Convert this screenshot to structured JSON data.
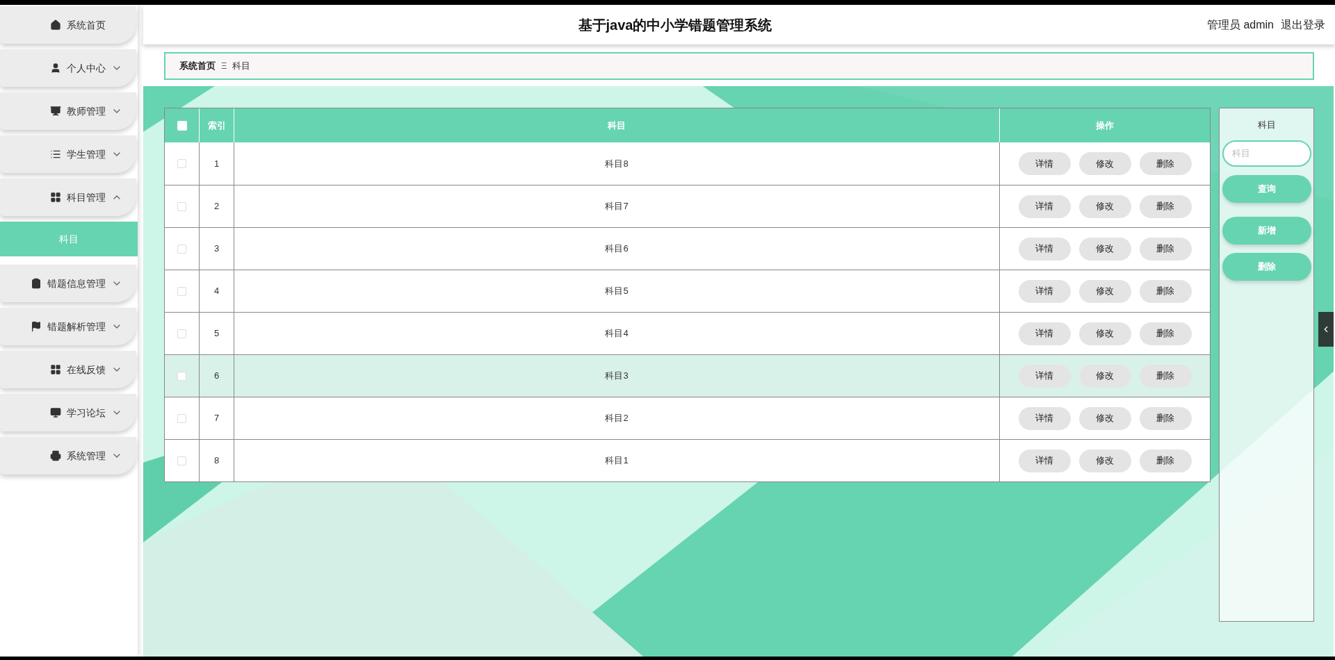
{
  "header": {
    "title": "基于java的中小学错题管理系统",
    "user": "管理员 admin",
    "logout": "退出登录"
  },
  "sidebar": {
    "items": [
      {
        "label": "系统首页"
      },
      {
        "label": "个人中心",
        "expanded": false
      },
      {
        "label": "教师管理",
        "expanded": false
      },
      {
        "label": "学生管理",
        "expanded": false
      },
      {
        "label": "科目管理",
        "expanded": true,
        "children": [
          {
            "label": "科目",
            "selected": true
          }
        ]
      },
      {
        "label": "错题信息管理",
        "expanded": false
      },
      {
        "label": "错题解析管理",
        "expanded": false
      },
      {
        "label": "在线反馈",
        "expanded": false
      },
      {
        "label": "学习论坛",
        "expanded": false
      },
      {
        "label": "系统管理",
        "expanded": false
      }
    ]
  },
  "breadcrumb": {
    "home": "系统首页",
    "separator": "Ξ",
    "current": "科目"
  },
  "table": {
    "header_checked": false,
    "columns": [
      "索引",
      "科目",
      "操作"
    ],
    "rows": [
      {
        "index": "1",
        "subject": "科目8",
        "checked": false,
        "highlighted": false,
        "actions": [
          "详情",
          "修改",
          "删除"
        ]
      },
      {
        "index": "2",
        "subject": "科目7",
        "checked": false,
        "highlighted": false,
        "actions": [
          "详情",
          "修改",
          "删除"
        ]
      },
      {
        "index": "3",
        "subject": "科目6",
        "checked": false,
        "highlighted": false,
        "actions": [
          "详情",
          "修改",
          "删除"
        ]
      },
      {
        "index": "4",
        "subject": "科目5",
        "checked": false,
        "highlighted": false,
        "actions": [
          "详情",
          "修改",
          "删除"
        ]
      },
      {
        "index": "5",
        "subject": "科目4",
        "checked": false,
        "highlighted": false,
        "actions": [
          "详情",
          "修改",
          "删除"
        ]
      },
      {
        "index": "6",
        "subject": "科目3",
        "checked": false,
        "highlighted": true,
        "actions": [
          "详情",
          "修改",
          "删除"
        ]
      },
      {
        "index": "7",
        "subject": "科目2",
        "checked": false,
        "highlighted": false,
        "actions": [
          "详情",
          "修改",
          "删除"
        ]
      },
      {
        "index": "8",
        "subject": "科目1",
        "checked": false,
        "highlighted": false,
        "actions": [
          "详情",
          "修改",
          "删除"
        ]
      }
    ]
  },
  "search_panel": {
    "label": "科目",
    "placeholder": "科目",
    "buttons": [
      "查询",
      "新增",
      "删除"
    ]
  }
}
